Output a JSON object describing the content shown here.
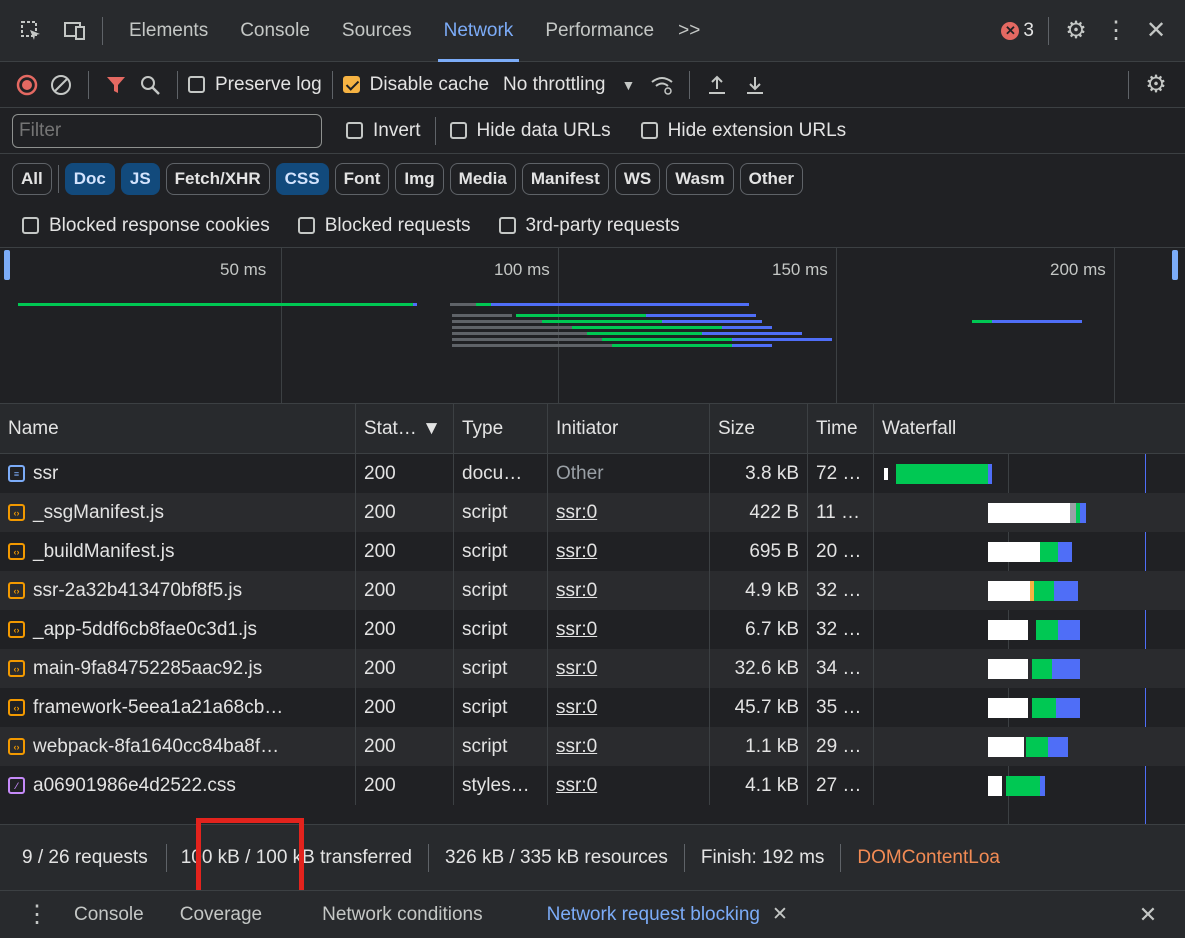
{
  "tabs": {
    "items": [
      "Elements",
      "Console",
      "Sources",
      "Network",
      "Performance"
    ],
    "more": ">>",
    "error_count": "3"
  },
  "toolbar": {
    "preserve_log": "Preserve log",
    "disable_cache": "Disable cache",
    "throttling": "No throttling"
  },
  "filter": {
    "placeholder": "Filter",
    "invert": "Invert",
    "hide_data_urls": "Hide data URLs",
    "hide_extension_urls": "Hide extension URLs"
  },
  "types": [
    "All",
    "Doc",
    "JS",
    "Fetch/XHR",
    "CSS",
    "Font",
    "Img",
    "Media",
    "Manifest",
    "WS",
    "Wasm",
    "Other"
  ],
  "types_selected": [
    "Doc",
    "JS",
    "CSS"
  ],
  "blocked": {
    "cookies": "Blocked response cookies",
    "requests": "Blocked requests",
    "third_party": "3rd-party requests"
  },
  "overview": {
    "ticks": [
      "50 ms",
      "100 ms",
      "150 ms",
      "200 ms"
    ]
  },
  "columns": {
    "name": "Name",
    "status": "Stat… ▼",
    "type": "Type",
    "initiator": "Initiator",
    "size": "Size",
    "time": "Time",
    "waterfall": "Waterfall"
  },
  "requests": [
    {
      "name": "ssr",
      "status": "200",
      "type": "docu…",
      "initiator": "Other",
      "size": "3.8 kB",
      "time": "72 …",
      "kind": "doc"
    },
    {
      "name": "_ssgManifest.js",
      "status": "200",
      "type": "script",
      "initiator": "ssr:0",
      "size": "422 B",
      "time": "11 …",
      "kind": "js"
    },
    {
      "name": "_buildManifest.js",
      "status": "200",
      "type": "script",
      "initiator": "ssr:0",
      "size": "695 B",
      "time": "20 …",
      "kind": "js"
    },
    {
      "name": "ssr-2a32b413470bf8f5.js",
      "status": "200",
      "type": "script",
      "initiator": "ssr:0",
      "size": "4.9 kB",
      "time": "32 …",
      "kind": "js"
    },
    {
      "name": "_app-5ddf6cb8fae0c3d1.js",
      "status": "200",
      "type": "script",
      "initiator": "ssr:0",
      "size": "6.7 kB",
      "time": "32 …",
      "kind": "js"
    },
    {
      "name": "main-9fa84752285aac92.js",
      "status": "200",
      "type": "script",
      "initiator": "ssr:0",
      "size": "32.6 kB",
      "time": "34 …",
      "kind": "js"
    },
    {
      "name": "framework-5eea1a21a68cb…",
      "status": "200",
      "type": "script",
      "initiator": "ssr:0",
      "size": "45.7 kB",
      "time": "35 …",
      "kind": "js"
    },
    {
      "name": "webpack-8fa1640cc84ba8f…",
      "status": "200",
      "type": "script",
      "initiator": "ssr:0",
      "size": "1.1 kB",
      "time": "29 …",
      "kind": "js"
    },
    {
      "name": "a06901986e4d2522.css",
      "status": "200",
      "type": "styles…",
      "initiator": "ssr:0",
      "size": "4.1 kB",
      "time": "27 …",
      "kind": "css"
    }
  ],
  "status": {
    "requests": "9 / 26 requests",
    "transferred": "100 kB / 100 kB transferred",
    "resources": "326 kB / 335 kB resources",
    "finish": "Finish: 192 ms",
    "dcl": "DOMContentLoa"
  },
  "drawer": {
    "tabs": [
      "Console",
      "Coverage",
      "Network conditions",
      "Network request blocking"
    ]
  },
  "colors": {
    "accent": "#7cacf8",
    "waiting": "#00c853",
    "download": "#4f6ef7",
    "dcl": "#f28b54",
    "highlight_box": "#e3231d"
  }
}
